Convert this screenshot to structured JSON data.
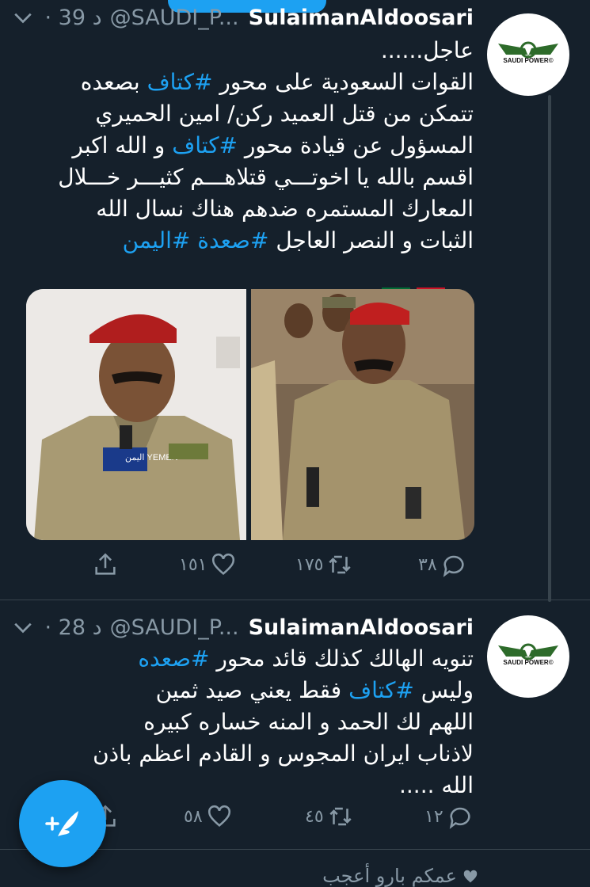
{
  "tweets": [
    {
      "name": "SulaimanAldoosari",
      "handle": "@SAUDI_P...",
      "time": "· 39 د",
      "avatar_label": "SAUDI POWER©",
      "lines": [
        [
          {
            "t": "عاجل......"
          }
        ],
        [
          {
            "t": "القوات السعودية على محور "
          },
          {
            "t": "#كتاف",
            "h": true
          },
          {
            "t": " بصعده"
          }
        ],
        [
          {
            "t": "تتمكن من قتل العميد ركن/ امين الحميري"
          }
        ],
        [
          {
            "t": "المسؤول عن قيادة محور "
          },
          {
            "t": "#كتاف",
            "h": true
          },
          {
            "t": " و الله اكبر"
          }
        ],
        [
          {
            "t": "اقسم بالله يا اخوتـــي قتلاهـــم كثيـــر خـــلال"
          }
        ],
        [
          {
            "t": "المعارك المستمره ضدهم هناك نسال الله"
          }
        ],
        [
          {
            "t": "الثبات و النصر العاجل "
          },
          {
            "t": "#صعدة",
            "h": true
          },
          {
            "t": " "
          },
          {
            "t": "#اليمن",
            "h": true
          }
        ]
      ],
      "media_caption": "اليمن YEMEN",
      "replies": "٣٨",
      "retweets": "١٧٥",
      "likes": "١٥١"
    },
    {
      "name": "SulaimanAldoosari",
      "handle": "@SAUDI_P...",
      "time": "· 28 د",
      "avatar_label": "SAUDI POWER©",
      "lines": [
        [
          {
            "t": "تنويه الهالك كذلك قائد محور "
          },
          {
            "t": "#صعده",
            "h": true
          }
        ],
        [
          {
            "t": "وليس "
          },
          {
            "t": "#كتاف",
            "h": true
          },
          {
            "t": " فقط يعني صيد ثمين"
          }
        ],
        [
          {
            "t": "اللهم لك الحمد و المنه خساره كبيره"
          }
        ],
        [
          {
            "t": "لاذناب ايران المجوس و القادم اعظم باذن"
          }
        ],
        [
          {
            "t": "الله ....."
          }
        ]
      ],
      "replies": "١٢",
      "retweets": "٤٥",
      "likes": "٥٨"
    }
  ],
  "footer": {
    "liked_text": "عمكم بارو أعجب"
  },
  "colors": {
    "bg": "#15202b",
    "accent": "#1da1f2",
    "muted": "#8899a6"
  },
  "icons": [
    "chevron-down-icon",
    "reply-icon",
    "retweet-icon",
    "like-icon",
    "share-icon",
    "compose-icon",
    "heart-icon"
  ]
}
